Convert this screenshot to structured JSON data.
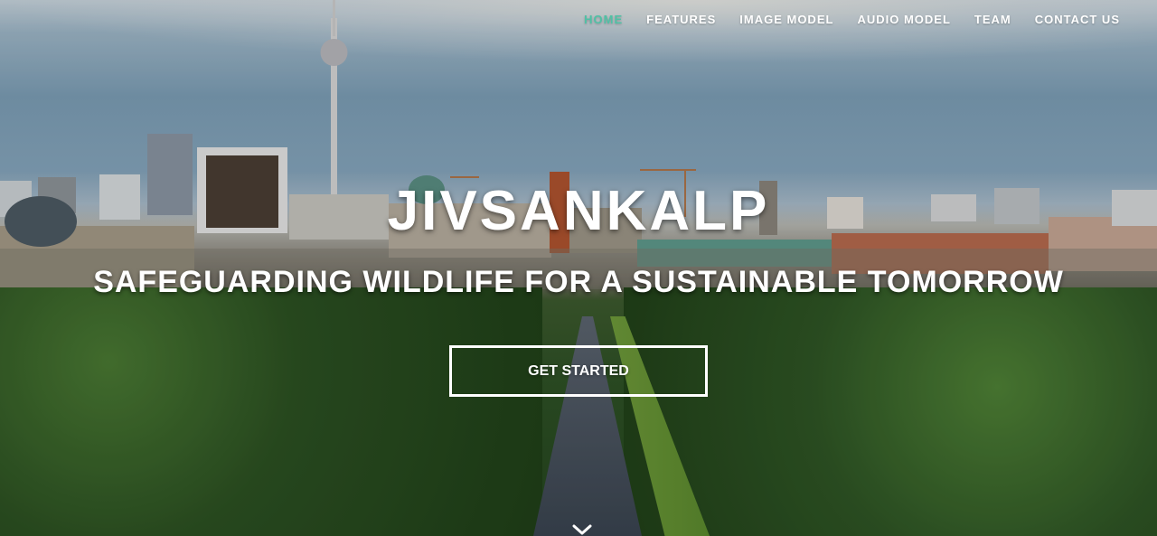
{
  "nav": {
    "items": [
      {
        "label": "HOME",
        "active": true
      },
      {
        "label": "FEATURES",
        "active": false
      },
      {
        "label": "IMAGE MODEL",
        "active": false
      },
      {
        "label": "AUDIO MODEL",
        "active": false
      },
      {
        "label": "TEAM",
        "active": false
      },
      {
        "label": "CONTACT US",
        "active": false
      }
    ]
  },
  "hero": {
    "title": "JIVSANKALP",
    "subtitle": "SAFEGUARDING WILDLIFE FOR A SUSTAINABLE TOMORROW",
    "cta_label": "GET STARTED",
    "scroll_icon": "chevron-down-icon"
  },
  "colors": {
    "accent": "#4fc1a5",
    "text": "#ffffff"
  }
}
